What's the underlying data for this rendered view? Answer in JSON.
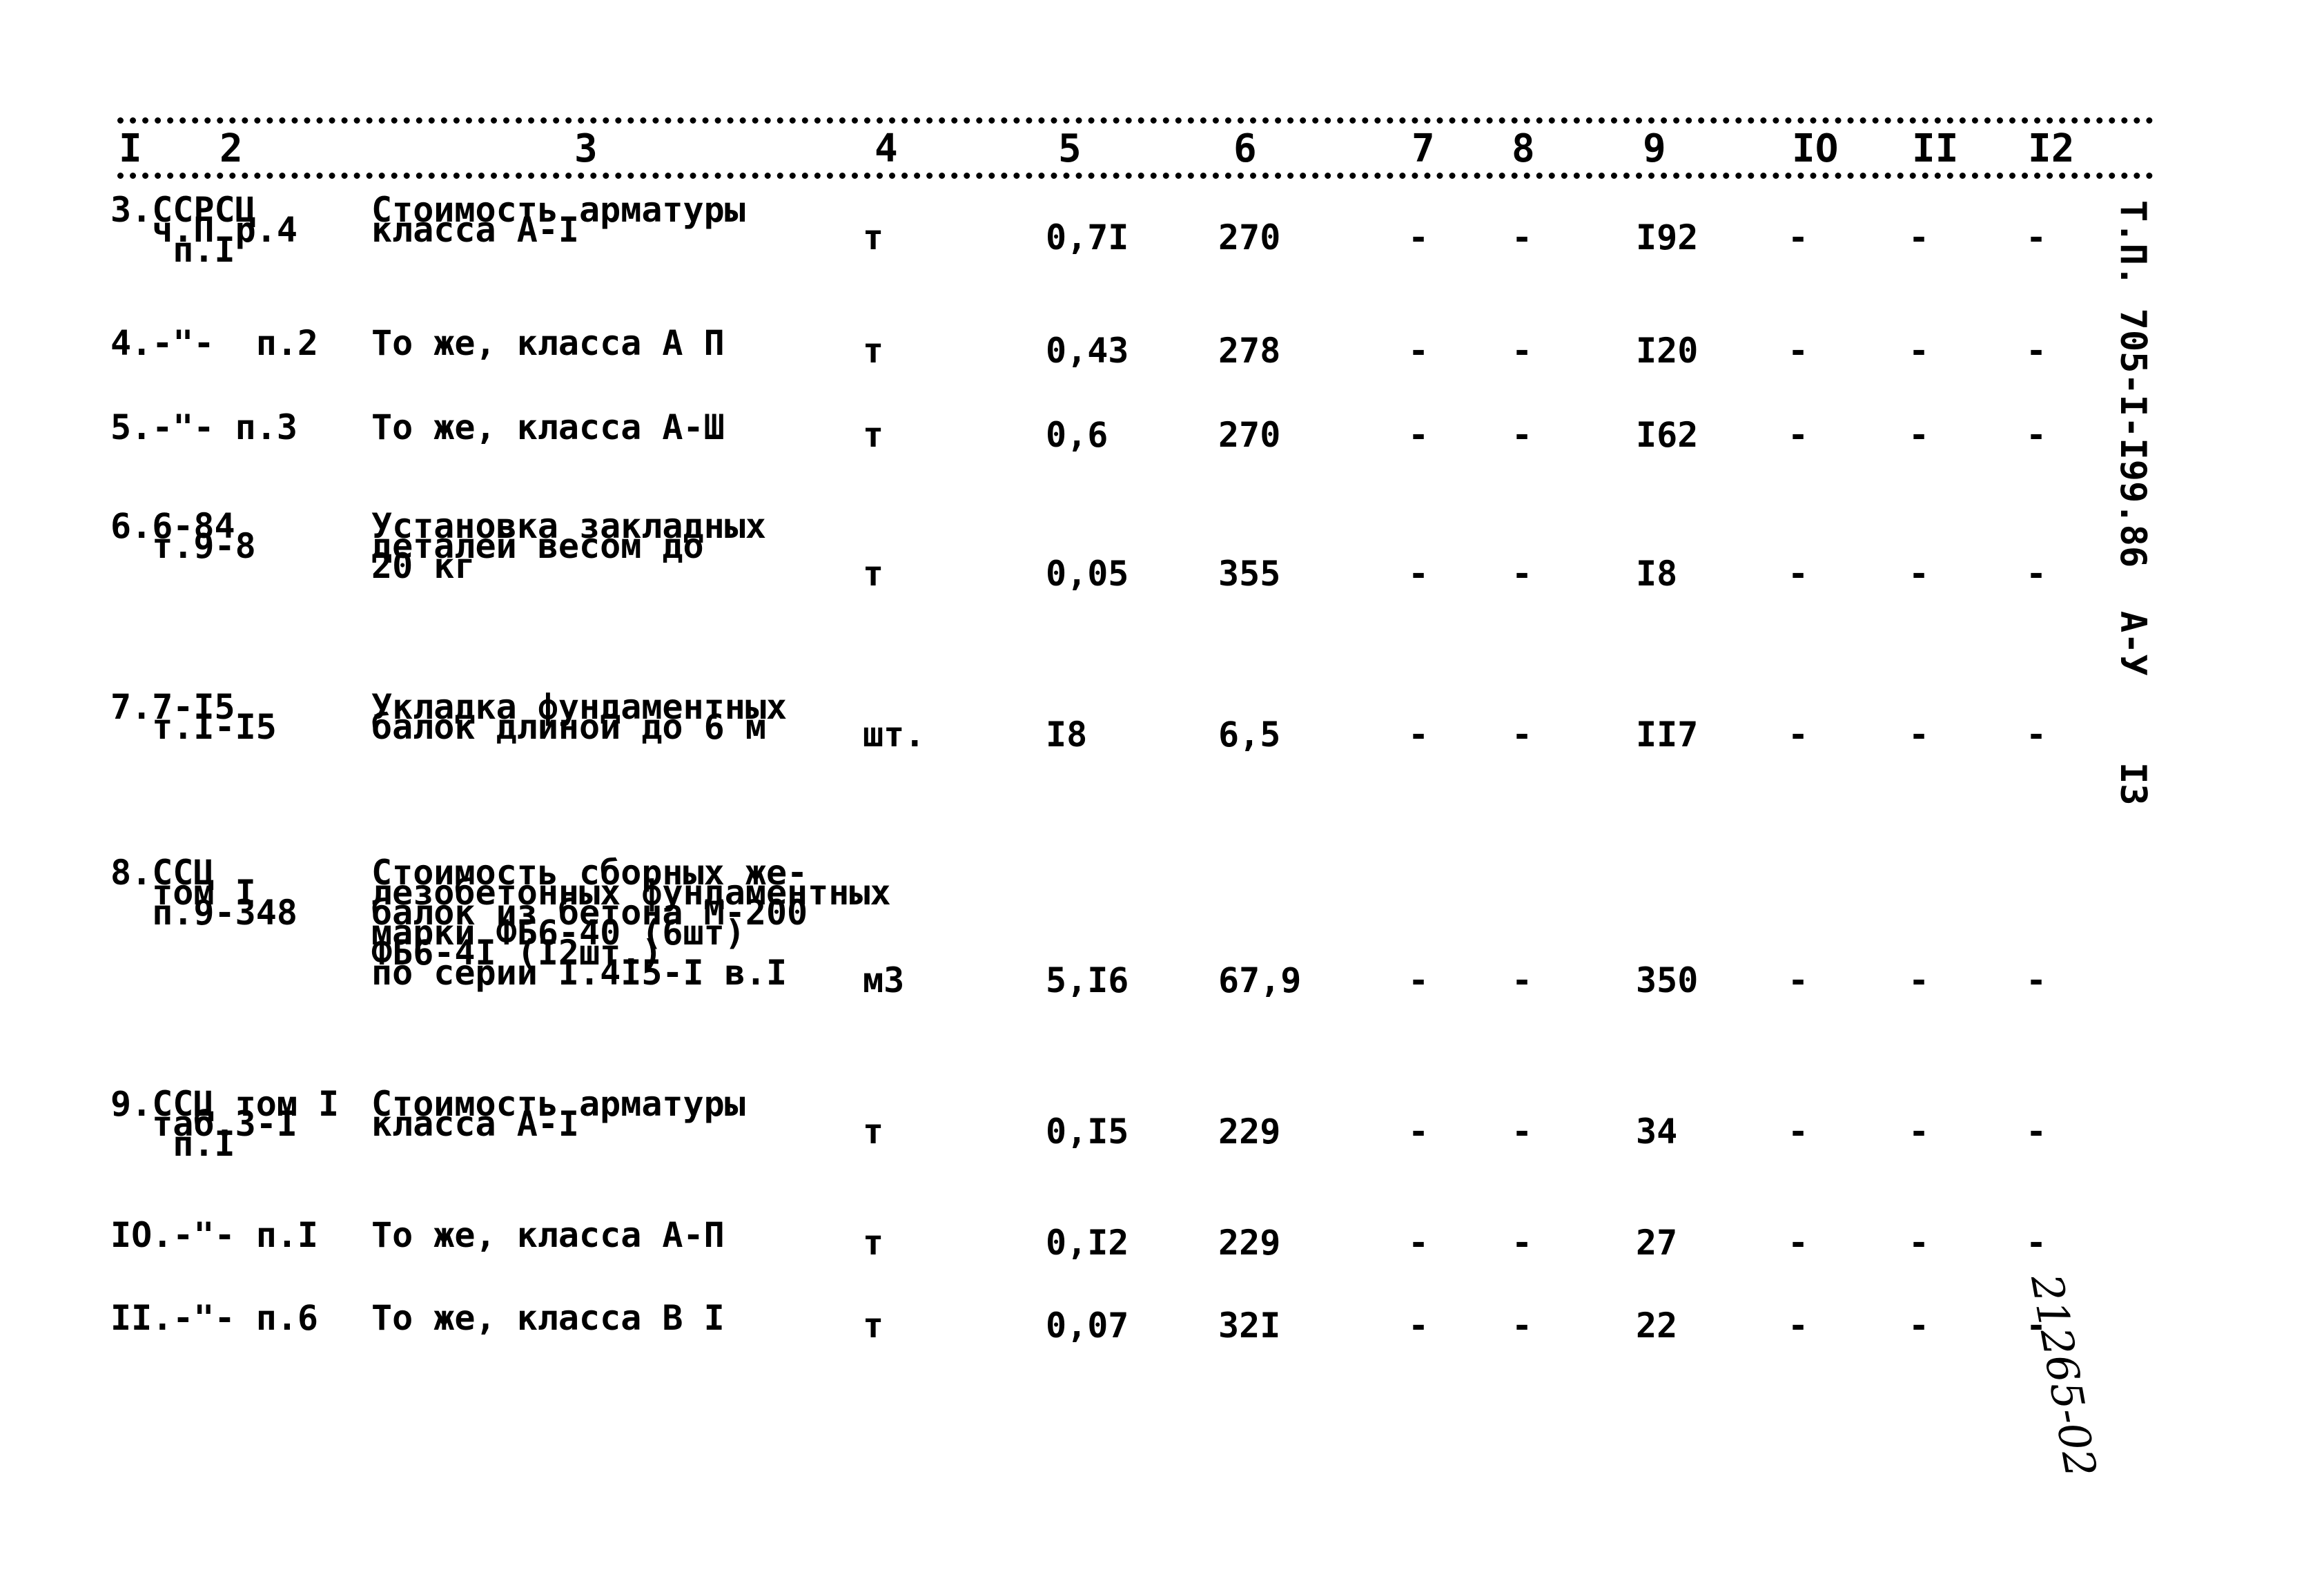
{
  "header": {
    "columns": [
      "I",
      "2",
      "3",
      "4",
      "5",
      "6",
      "7",
      "8",
      "9",
      "IO",
      "II",
      "I2"
    ]
  },
  "rows": [
    {
      "ref": "3.ССРСЦ\n  ч.П р.4\n   п.I",
      "desc": "Стоимость арматуры\nкласса А-I",
      "unit": "т",
      "qty": "0,7I",
      "price": "270",
      "c7": "-",
      "c8": "-",
      "c9": "I92",
      "c10": "-",
      "c11": "-",
      "c12": "-"
    },
    {
      "ref": "4.-\"-  п.2",
      "desc": "То же, класса А П",
      "unit": "т",
      "qty": "0,43",
      "price": "278",
      "c7": "-",
      "c8": "-",
      "c9": "I20",
      "c10": "-",
      "c11": "-",
      "c12": "-"
    },
    {
      "ref": "5.-\"- п.3",
      "desc": "То же, класса А-Ш",
      "unit": "т",
      "qty": "0,6",
      "price": "270",
      "c7": "-",
      "c8": "-",
      "c9": "I62",
      "c10": "-",
      "c11": "-",
      "c12": "-"
    },
    {
      "ref": "6.6-84\n  т.9-8",
      "desc": "Установка закладных\nдеталей весом до\n20 кг",
      "unit": "т",
      "qty": "0,05",
      "price": "355",
      "c7": "-",
      "c8": "-",
      "c9": "I8",
      "c10": "-",
      "c11": "-",
      "c12": "-"
    },
    {
      "ref": "7.7-I5\n  т.I-I5",
      "desc": "Укладка фундаментных\nбалок длиной до 6 м",
      "unit": "шт.",
      "qty": "I8",
      "price": "6,5",
      "c7": "-",
      "c8": "-",
      "c9": "II7",
      "c10": "-",
      "c11": "-",
      "c12": "-"
    },
    {
      "ref": "8.ССЦ\n  том I\n  п.9-348",
      "desc": "Стоимость сборных же-\nлезобетонных фундаментных\nбалок из бетона М-200\nмарки ФБ6-40 (6шт)\nФБ6-4I (I2шт.)\nпо серии I.4I5-I в.I",
      "unit": "м3",
      "qty": "5,I6",
      "price": "67,9",
      "c7": "-",
      "c8": "-",
      "c9": "350",
      "c10": "-",
      "c11": "-",
      "c12": "-"
    },
    {
      "ref": "9.ССЦ том I\n  таб.3-I\n   п.I",
      "desc": "Стоимость арматуры\nкласса А-I",
      "unit": "т",
      "qty": "0,I5",
      "price": "229",
      "c7": "-",
      "c8": "-",
      "c9": "34",
      "c10": "-",
      "c11": "-",
      "c12": "-"
    },
    {
      "ref": "IO.-\"- п.I",
      "desc": "То же, класса А-П",
      "unit": "т",
      "qty": "0,I2",
      "price": "229",
      "c7": "-",
      "c8": "-",
      "c9": "27",
      "c10": "-",
      "c11": "-",
      "c12": "-"
    },
    {
      "ref": "II.-\"- п.6",
      "desc": "То же, класса В I",
      "unit": "т",
      "qty": "0,07",
      "price": "32I",
      "c7": "-",
      "c8": "-",
      "c9": "22",
      "c10": "-",
      "c11": "-",
      "c12": "-"
    }
  ],
  "side_code": "Т.П. 705-I-I99.86  А-У    I3",
  "stamp": "21265-02"
}
